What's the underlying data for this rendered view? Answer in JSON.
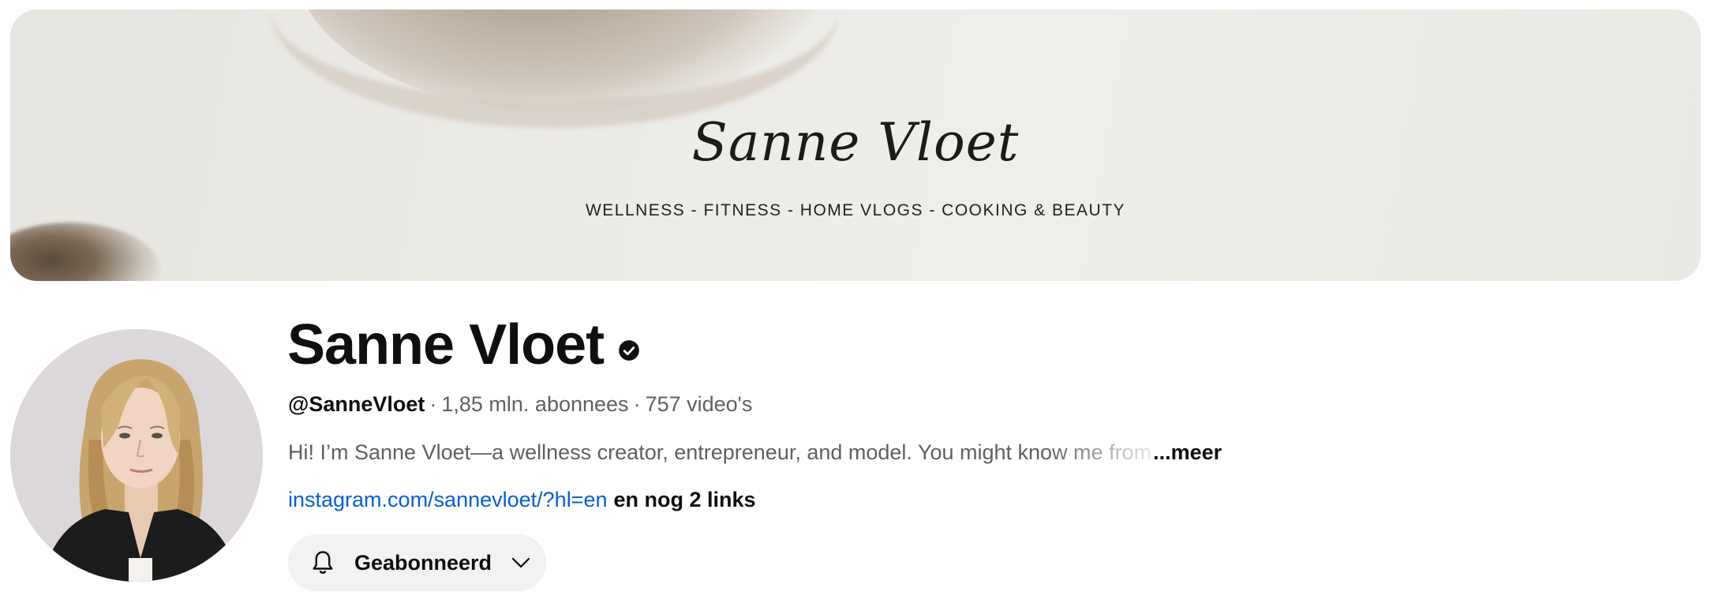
{
  "banner": {
    "title": "Sanne Vloet",
    "tagline": "WELLNESS - FITNESS - HOME VLOGS - COOKING &  BEAUTY"
  },
  "channel": {
    "name": "Sanne Vloet",
    "verified_icon": "verified-check-icon",
    "handle": "@SanneVloet",
    "subscribers": "1,85 mln. abonnees",
    "videos": "757 video's",
    "separator": "·",
    "description": "Hi! I’m Sanne Vloet—a wellness creator, entrepreneur, and  model. You might know me from",
    "more_label": "...meer",
    "link_url": "instagram.com/sannevloet/?hl=en",
    "more_links": "en nog 2 links"
  },
  "subscribe_button": {
    "label": "Geabonneerd",
    "icon": "bell-icon",
    "dropdown_icon": "chevron-down-icon"
  },
  "colors": {
    "link": "#065fd4",
    "text_primary": "#0f0f0f",
    "text_secondary": "#606060",
    "button_bg": "#f2f2f2"
  }
}
